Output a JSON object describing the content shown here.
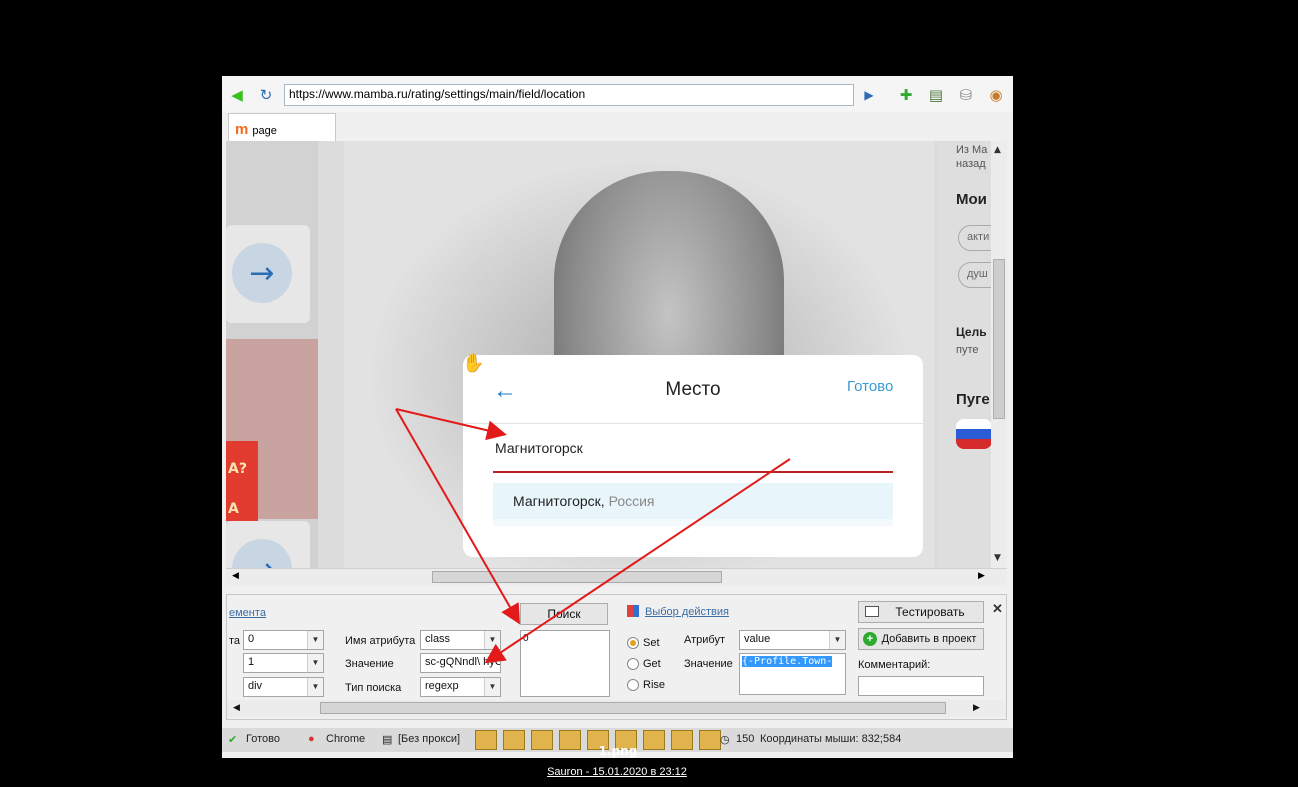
{
  "browser": {
    "url": "https://www.mamba.ru/rating/settings/main/field/location",
    "tab_label": "page",
    "tab_logo": "m"
  },
  "page": {
    "right_texts": [
      "Из Ма",
      "назад",
      "Мои",
      "акти",
      "душ",
      "Цель",
      "путе",
      "Пуге"
    ]
  },
  "modal": {
    "title": "Место",
    "done_label": "Готово",
    "back_icon": "arrow-left-icon",
    "input_value": "Магнитогорск",
    "suggestion_city": "Магнитогорск,",
    "suggestion_country": "Россия"
  },
  "panel": {
    "element_link": "ементa",
    "left_label": "та",
    "left_combo1": "0",
    "left_combo2": "1",
    "left_combo3": "div",
    "attr_name_label": "Имя атрибута",
    "attr_name_value": "class",
    "value_label": "Значение",
    "value_value": "sc-gQNndl\\ hyC",
    "search_type_label": "Тип поиска",
    "search_type_value": "regexp",
    "search_button": "Поиск",
    "result_item": "0",
    "action_link": "Выбор действия",
    "radio_set": "Set",
    "radio_get": "Get",
    "radio_rise": "Rise",
    "attribute_label": "Атрибут",
    "attribute_value": "value",
    "value2_label": "Значение",
    "value2_value": "{-Profile.Town-",
    "test_button": "Тестировать",
    "add_button": "Добавить в проект",
    "comment_label": "Комментарий:"
  },
  "status": {
    "ready": "Готово",
    "browser": "Chrome",
    "proxy": "[Без прокси]",
    "count": "150",
    "mouse": "Координаты мыши: 832;584"
  },
  "overlay": {
    "filename": "1.png",
    "caption": "Sauron - 15.01.2020 в 23:12"
  },
  "colors": {
    "annotation_arrow": "#e21a1a",
    "accent": "#1a7ac3"
  }
}
